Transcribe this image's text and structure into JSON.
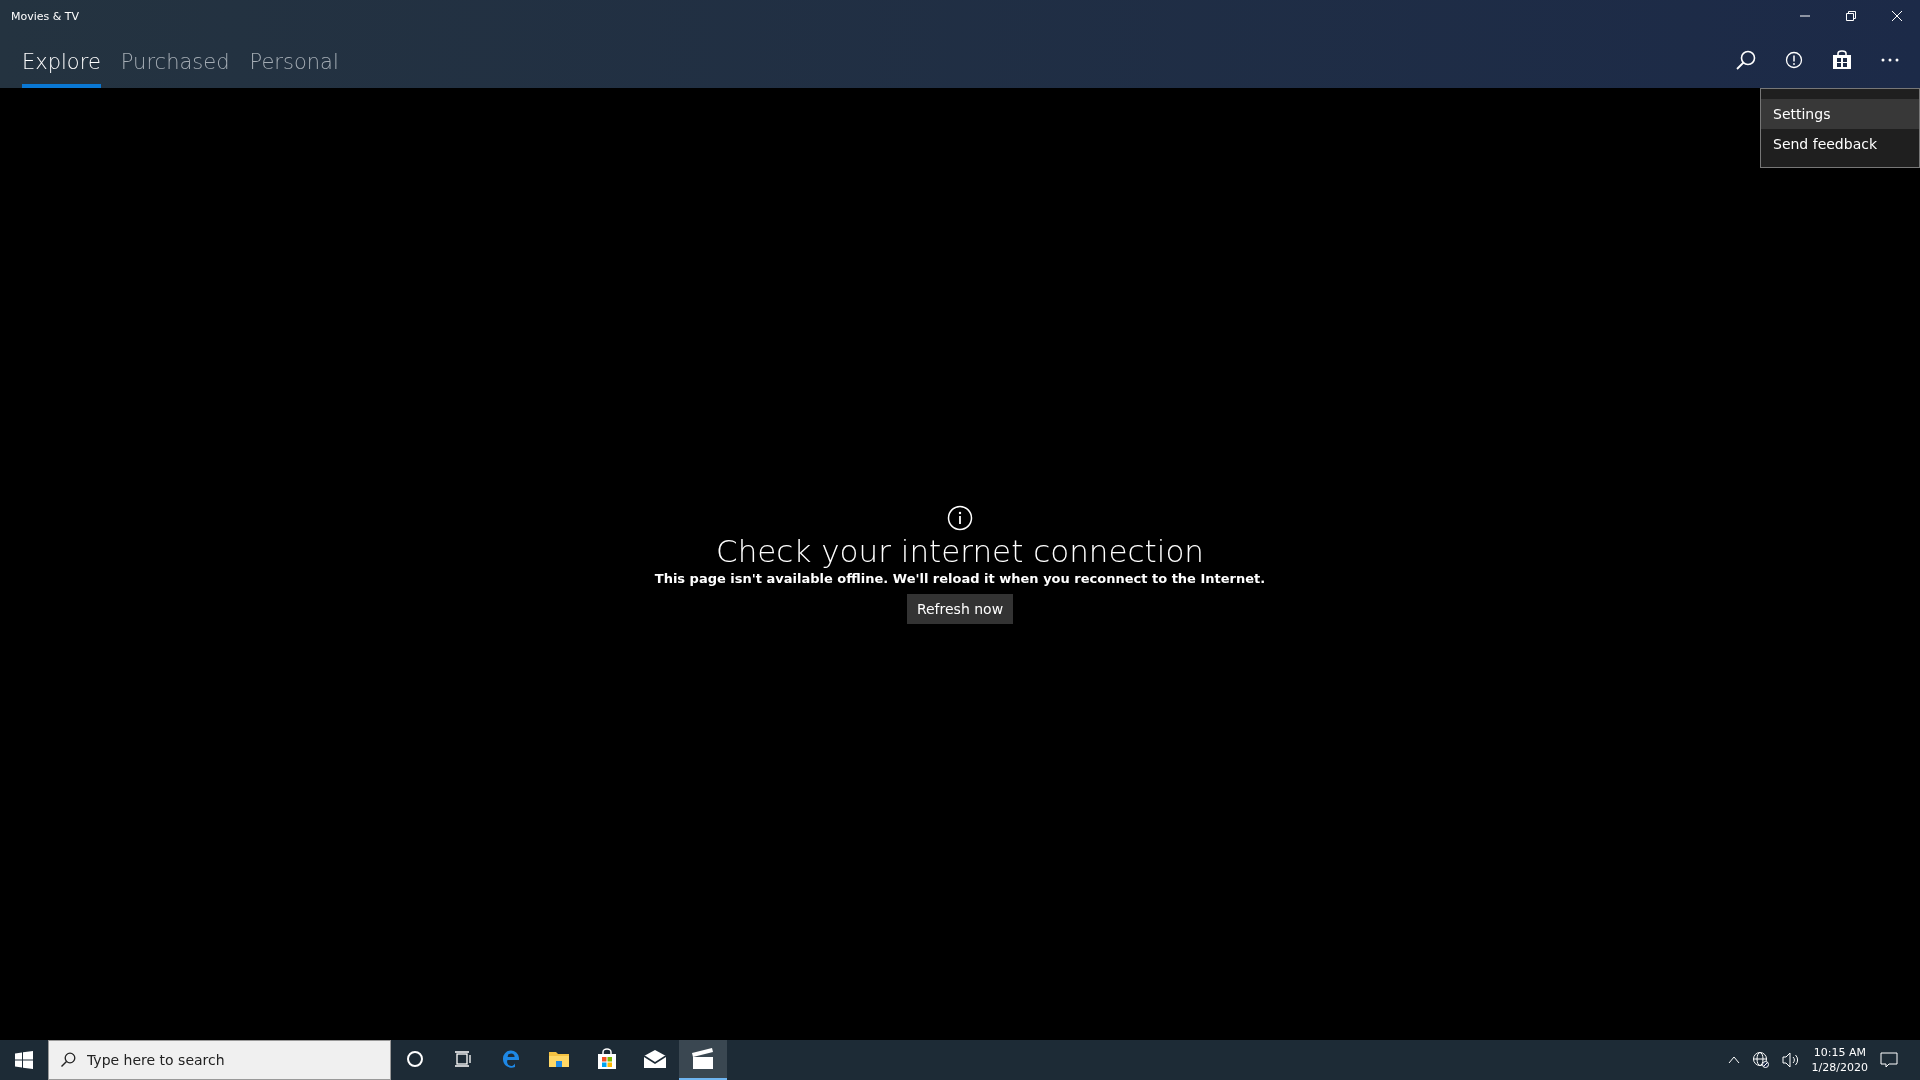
{
  "window": {
    "title": "Movies & TV"
  },
  "tabs": [
    {
      "label": "Explore",
      "selected": true
    },
    {
      "label": "Purchased",
      "selected": false
    },
    {
      "label": "Personal",
      "selected": false
    }
  ],
  "menu": {
    "items": [
      {
        "label": "Settings",
        "selected": true
      },
      {
        "label": "Send feedback",
        "selected": false
      }
    ]
  },
  "message": {
    "title": "Check your internet connection",
    "body": "This page isn't available offline. We'll reload it when you reconnect to the Internet.",
    "button": "Refresh now"
  },
  "taskbar": {
    "search": {
      "placeholder": "Type here to search"
    },
    "apps": [
      {
        "kind": "cortana",
        "selected": false
      },
      {
        "kind": "taskview",
        "selected": false
      },
      {
        "kind": "edge",
        "selected": false
      },
      {
        "kind": "explorer",
        "selected": false
      },
      {
        "kind": "store",
        "selected": false
      },
      {
        "kind": "mail",
        "selected": false
      },
      {
        "kind": "movies",
        "selected": true
      }
    ],
    "clock": {
      "time": "10:15 AM",
      "date": "1/28/2020"
    }
  }
}
